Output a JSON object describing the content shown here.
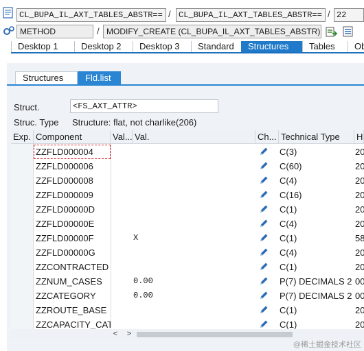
{
  "toolbar": {
    "program_field": "CL_BUPA_IL_AXT_TABLES_ABSTR==",
    "include_field": "CL_BUPA_IL_AXT_TABLES_ABSTR==",
    "line_field": "22",
    "type_field": "METHOD",
    "method_field": "MODIFY_CREATE (CL_BUPA_IL_AXT_TABLES_ABSTR)",
    "separator": "/"
  },
  "tabs": [
    {
      "label": "Desktop 1"
    },
    {
      "label": "Desktop 2"
    },
    {
      "label": "Desktop 3"
    },
    {
      "label": "Standard"
    },
    {
      "label": "Structures",
      "active": true
    },
    {
      "label": "Tables"
    },
    {
      "label": "Ob"
    }
  ],
  "subtabs": [
    {
      "label": "Structures"
    },
    {
      "label": "Fld.list",
      "active": true
    }
  ],
  "struct": {
    "label": "Struct.",
    "value": "<FS_AXT_ATTR>",
    "type_label": "Struc. Type",
    "type_value": "Structure: flat, not charlike(206)"
  },
  "grid": {
    "headers": [
      "Exp.",
      "Component",
      "Val...",
      "Val.",
      "Ch...",
      "Technical Type",
      "He"
    ],
    "rows": [
      {
        "component": "ZZFLD000004",
        "val": "",
        "type": "C(3)",
        "he": "20"
      },
      {
        "component": "ZZFLD000006",
        "val": "",
        "type": "C(60)",
        "he": "20"
      },
      {
        "component": "ZZFLD000008",
        "val": "",
        "type": "C(4)",
        "he": "20"
      },
      {
        "component": "ZZFLD000009",
        "val": "",
        "type": "C(16)",
        "he": "20"
      },
      {
        "component": "ZZFLD00000D",
        "val": "",
        "type": "C(1)",
        "he": "20"
      },
      {
        "component": "ZZFLD00000E",
        "val": "",
        "type": "C(4)",
        "he": "20"
      },
      {
        "component": "ZZFLD00000F",
        "val": "X",
        "type": "C(1)",
        "he": "58"
      },
      {
        "component": "ZZFLD00000G",
        "val": "",
        "type": "C(4)",
        "he": "20"
      },
      {
        "component": "ZZCONTRACTED",
        "val": "",
        "type": "C(1)",
        "he": "20"
      },
      {
        "component": "ZZNUM_CASES",
        "val": "0.00",
        "type": "P(7) DECIMALS 2",
        "he": "00"
      },
      {
        "component": "ZZCATEGORY",
        "val": "0.00",
        "type": "P(7) DECIMALS 2",
        "he": "00"
      },
      {
        "component": "ZZROUTE_BASE",
        "val": "",
        "type": "C(1)",
        "he": "20"
      },
      {
        "component": "ZZCAPACITY_CAT...",
        "val": "",
        "type": "C(1)",
        "he": "20"
      }
    ]
  },
  "scroll": {
    "left": "<",
    "right": ">"
  },
  "watermark": "@稀土掘金技术社区",
  "colors": {
    "accent": "#1f7ac9",
    "pencil": "#2d6cb5"
  }
}
